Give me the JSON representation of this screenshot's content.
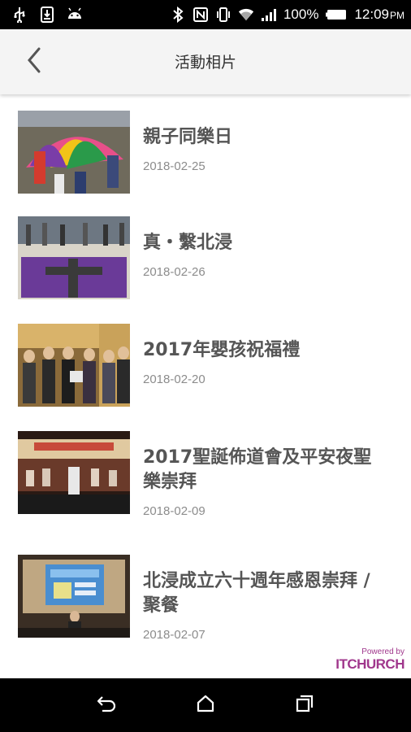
{
  "status_bar": {
    "battery_percent": "100%",
    "time": "12:09",
    "time_suffix": "PM",
    "left_icons": [
      "usb-icon",
      "download-icon",
      "android-icon"
    ],
    "right_icons": [
      "bluetooth-icon",
      "nfc-icon",
      "vibrate-icon",
      "wifi-icon",
      "signal-icon",
      "battery-icon"
    ]
  },
  "app_bar": {
    "title": "活動相片",
    "back_icon": "chevron-left-icon"
  },
  "albums": [
    {
      "title": "親子同樂日",
      "date": "2018-02-25"
    },
    {
      "title": "真・繫北浸",
      "date": "2018-02-26"
    },
    {
      "title": "2017年嬰孩祝福禮",
      "date": "2018-02-20"
    },
    {
      "title": "2017聖誕佈道會及平安夜聖樂崇拜",
      "date": "2018-02-09"
    },
    {
      "title": "北浸成立六十週年感恩崇拜 / 聚餐",
      "date": "2018-02-07"
    }
  ],
  "powered": {
    "by": "Powered by",
    "brand": "ITCHURCH"
  },
  "nav_bar": {
    "icons": [
      "back-icon",
      "home-icon",
      "recents-icon"
    ]
  },
  "colors": {
    "brand": "#a0378c",
    "title_text": "#555555",
    "date_text": "#8c8c8c",
    "app_bar_bg": "#f4f4f4"
  }
}
